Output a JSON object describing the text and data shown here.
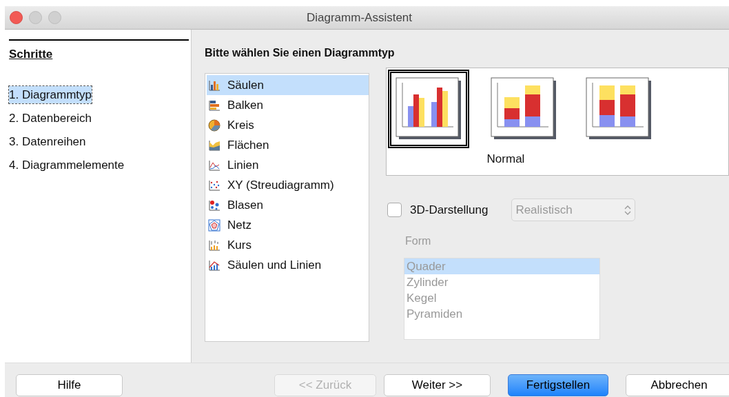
{
  "window": {
    "title": "Diagramm-Assistent"
  },
  "steps": {
    "title": "Schritte",
    "items": [
      {
        "label": "1. Diagrammtyp",
        "selected": true
      },
      {
        "label": "2. Datenbereich",
        "selected": false
      },
      {
        "label": "3. Datenreihen",
        "selected": false
      },
      {
        "label": "4. Diagrammelemente",
        "selected": false
      }
    ]
  },
  "heading": "Bitte wählen Sie einen Diagrammtyp",
  "chart_types": [
    {
      "label": "Säulen",
      "kind": "column",
      "selected": true
    },
    {
      "label": "Balken",
      "kind": "bar",
      "selected": false
    },
    {
      "label": "Kreis",
      "kind": "pie",
      "selected": false
    },
    {
      "label": "Flächen",
      "kind": "area",
      "selected": false
    },
    {
      "label": "Linien",
      "kind": "line",
      "selected": false
    },
    {
      "label": "XY (Streudiagramm)",
      "kind": "scatter",
      "selected": false
    },
    {
      "label": "Blasen",
      "kind": "bubble",
      "selected": false
    },
    {
      "label": "Netz",
      "kind": "net",
      "selected": false
    },
    {
      "label": "Kurs",
      "kind": "stock",
      "selected": false
    },
    {
      "label": "Säulen und Linien",
      "kind": "columnline",
      "selected": false
    }
  ],
  "variants": [
    {
      "kind": "normal",
      "selected": true
    },
    {
      "kind": "stacked",
      "selected": false
    },
    {
      "kind": "percent",
      "selected": false
    }
  ],
  "variant_label": "Normal",
  "three_d": {
    "label": "3D-Darstellung",
    "checked": false,
    "select": {
      "value": "Realistisch",
      "disabled": true
    }
  },
  "form": {
    "label": "Form",
    "disabled": true,
    "items": [
      {
        "label": "Quader",
        "selected": true
      },
      {
        "label": "Zylinder",
        "selected": false
      },
      {
        "label": "Kegel",
        "selected": false
      },
      {
        "label": "Pyramiden",
        "selected": false
      }
    ]
  },
  "buttons": [
    {
      "label": "Hilfe",
      "kind": "normal",
      "disabled": false
    },
    {
      "label": "<< Zurück",
      "kind": "normal",
      "disabled": true
    },
    {
      "label": "Weiter >>",
      "kind": "normal",
      "disabled": false
    },
    {
      "label": "Fertigstellen",
      "kind": "default",
      "disabled": false
    },
    {
      "label": "Abbrechen",
      "kind": "normal",
      "disabled": false
    }
  ]
}
